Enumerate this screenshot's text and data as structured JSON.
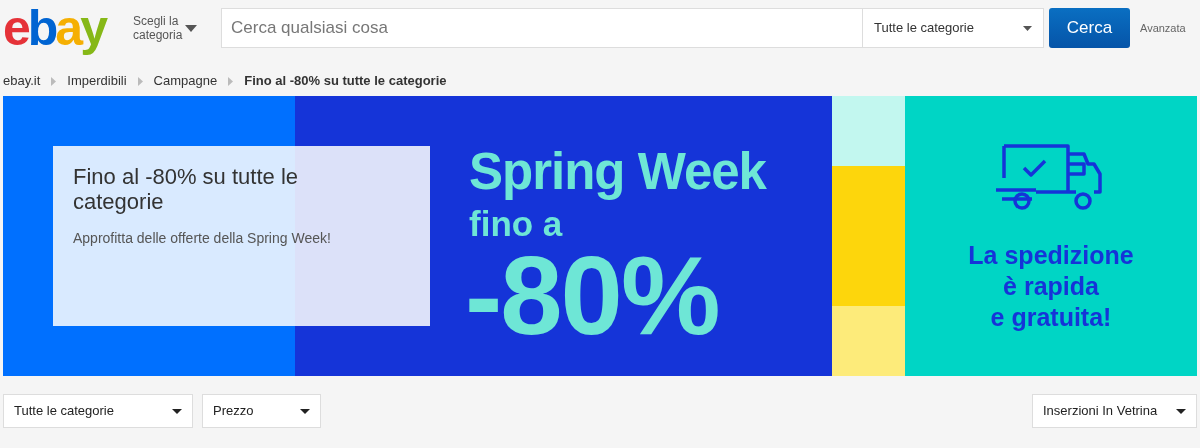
{
  "header": {
    "logo": "ebay",
    "category_menu": "Scegli la categoria",
    "search": {
      "placeholder": "Cerca qualsiasi cosa"
    },
    "category_select": "Tutte le categorie",
    "search_button": "Cerca",
    "advanced_link": "Avanzata"
  },
  "breadcrumbs": [
    {
      "label": "ebay.it",
      "current": false
    },
    {
      "label": "Imperdibili",
      "current": false
    },
    {
      "label": "Campagne",
      "current": false
    },
    {
      "label": "Fino al -80% su tutte le categorie",
      "current": true
    }
  ],
  "banner": {
    "card_title": "Fino al -80% su tutte le categorie",
    "card_text": "Approfitta delle offerte della Spring Week!",
    "headline": "Spring Week",
    "subline": "fino a",
    "discount": "-80%",
    "shipping_text": [
      "La spedizione",
      "è rapida",
      "e gratuita!"
    ]
  },
  "filters": [
    {
      "label": "Tutte le categorie"
    },
    {
      "label": "Prezzo"
    }
  ],
  "sort": "Inserzioni In Vetrina"
}
